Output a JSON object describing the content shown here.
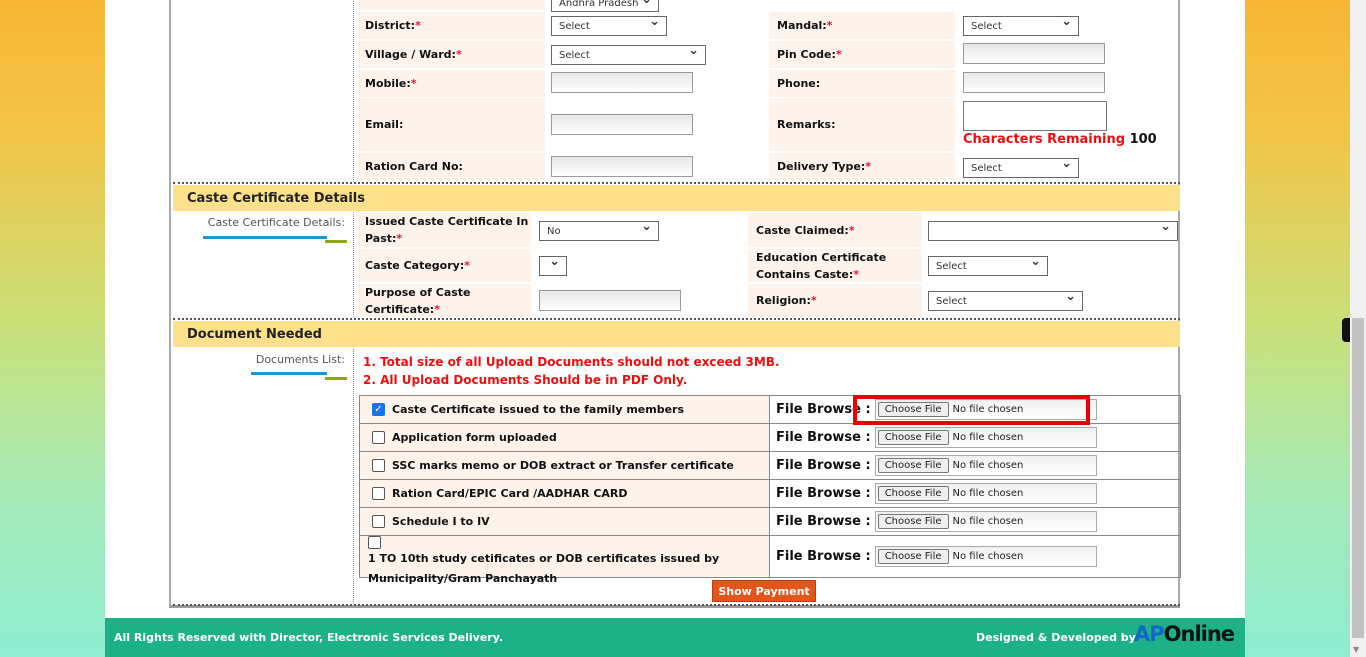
{
  "contact": {
    "state_value": "Andhra Pradesh",
    "district_label": "District:",
    "district_value": "Select",
    "mandal_label": "Mandal:",
    "mandal_value": "Select",
    "village_label": "Village / Ward:",
    "village_value": "Select",
    "pincode_label": "Pin Code:",
    "mobile_label": "Mobile:",
    "phone_label": "Phone:",
    "email_label": "Email:",
    "remarks_label": "Remarks:",
    "chars_remaining_label": "Characters Remaining",
    "chars_remaining_value": "100",
    "ration_label": "Ration Card No:",
    "delivery_label": "Delivery Type:",
    "delivery_value": "Select"
  },
  "caste": {
    "header": "Caste Certificate Details",
    "side_label": "Caste Certificate Details:",
    "issued_label": "Issued Caste Certificate In Past:",
    "issued_value": "No",
    "claimed_label": "Caste Claimed:",
    "claimed_value": "",
    "category_label": "Caste Category:",
    "category_value": "",
    "edu_label": "Education Certificate Contains Caste:",
    "edu_value": "Select",
    "purpose_label": "Purpose of Caste Certificate:",
    "religion_label": "Religion:",
    "religion_value": "Select",
    "required_mark": "*"
  },
  "documents": {
    "header": "Document Needed",
    "side_label": "Documents List:",
    "notes": [
      "1. Total size of all Upload Documents should not exceed 3MB.",
      "2. All Upload Documents Should be in PDF Only."
    ],
    "file_browse_label": "File Browse :",
    "choose_file": "Choose File",
    "no_file": "No file chosen",
    "items": [
      {
        "label": "Caste Certificate issued to the family members",
        "checked": true
      },
      {
        "label": "Application form uploaded",
        "checked": false
      },
      {
        "label": "SSC marks memo or DOB extract or Transfer certificate",
        "checked": false
      },
      {
        "label": "Ration Card/EPIC Card /AADHAR CARD",
        "checked": false
      },
      {
        "label": "Schedule I to IV",
        "checked": false
      },
      {
        "label": "1 TO 10th study cetificates or DOB certificates issued by Municipality/Gram Panchayath",
        "checked": false
      }
    ],
    "show_payment": "Show Payment"
  },
  "footer": {
    "left": "All Rights Reserved with Director, Electronic Services Delivery.",
    "right": "Designed & Developed by",
    "logo": "APOnline"
  },
  "colors": {
    "section_header": "#fde08a",
    "label_bg": "#fdf3ea",
    "footer": "#1db188",
    "button": "#e2561b",
    "highlight": "#ee0000"
  }
}
